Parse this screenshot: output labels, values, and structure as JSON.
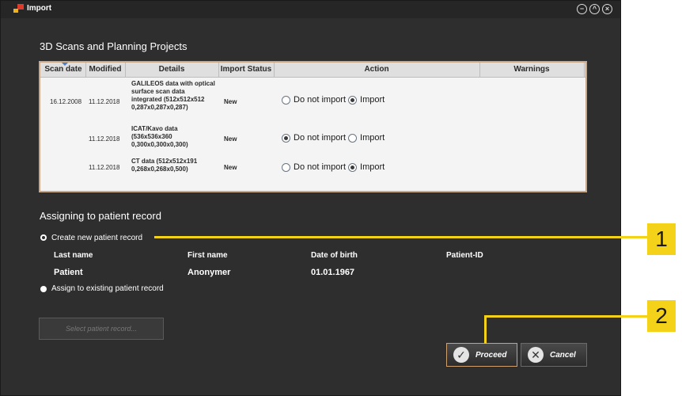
{
  "window": {
    "title": "Import"
  },
  "scans_section": {
    "title": "3D Scans and Planning Projects",
    "columns": [
      "Scan date",
      "Modified",
      "Details",
      "Import Status",
      "Action",
      "Warnings"
    ],
    "rows": [
      {
        "scan_date": "16.12.2008",
        "modified": "11.12.2018",
        "details": [
          "GALILEOS data with optical",
          "surface scan data",
          "integrated (512x512x512",
          "0,287x0,287x0,287)"
        ],
        "status": "New",
        "opt_no": "Do not import",
        "opt_yes": "Import",
        "selected": "import"
      },
      {
        "scan_date": "",
        "modified": "11.12.2018",
        "details": [
          "ICAT/Kavo data",
          "(536x536x360",
          "0,300x0,300x0,300)"
        ],
        "status": "New",
        "opt_no": "Do not import",
        "opt_yes": "Import",
        "selected": "do_not_import"
      },
      {
        "scan_date": "",
        "modified": "11.12.2018",
        "details": [
          "CT data (512x512x191",
          "0,268x0,268x0,500)"
        ],
        "status": "New",
        "opt_no": "Do not import",
        "opt_yes": "Import",
        "selected": "import"
      }
    ]
  },
  "assign_section": {
    "title": "Assigning to patient record",
    "create_label": "Create new patient record",
    "existing_label": "Assign to existing patient record",
    "selected": "create",
    "fields": {
      "last_name_label": "Last name",
      "first_name_label": "First name",
      "dob_label": "Date of birth",
      "patient_id_label": "Patient-ID"
    },
    "patient": {
      "last_name": "Patient",
      "first_name": "Anonymer",
      "dob": "01.01.1967",
      "patient_id": ""
    },
    "select_button": "Select patient record..."
  },
  "buttons": {
    "proceed": "Proceed",
    "cancel": "Cancel"
  },
  "callouts": [
    "1",
    "2"
  ],
  "colors": {
    "callout": "#f4d21a",
    "proceed_border": "#d0a070",
    "background": "#2e2e2e"
  }
}
